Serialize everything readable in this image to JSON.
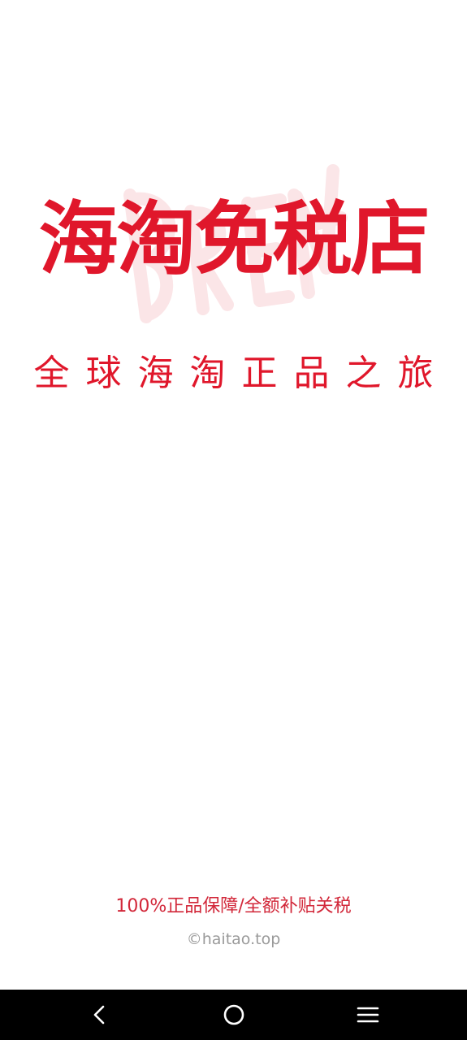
{
  "splash": {
    "title": "海淘免税店",
    "tagline": "全球海淘正品之旅",
    "watermark_text": "DREAM",
    "promise": "100%正品保障/全额补贴关税",
    "copyright": "©haitao.top"
  },
  "navigation_bar": {
    "back_icon": "chevron-left-icon",
    "home_icon": "circle-home-icon",
    "recents_icon": "menu-lines-icon"
  },
  "colors": {
    "brand_red": "#e0172b",
    "promise_red": "#d2283a",
    "watermark_pink": "#fbe3e5",
    "copyright_gray": "#9a9a9a",
    "navbar_bg": "#000000",
    "navbar_icon": "#ffffff"
  }
}
